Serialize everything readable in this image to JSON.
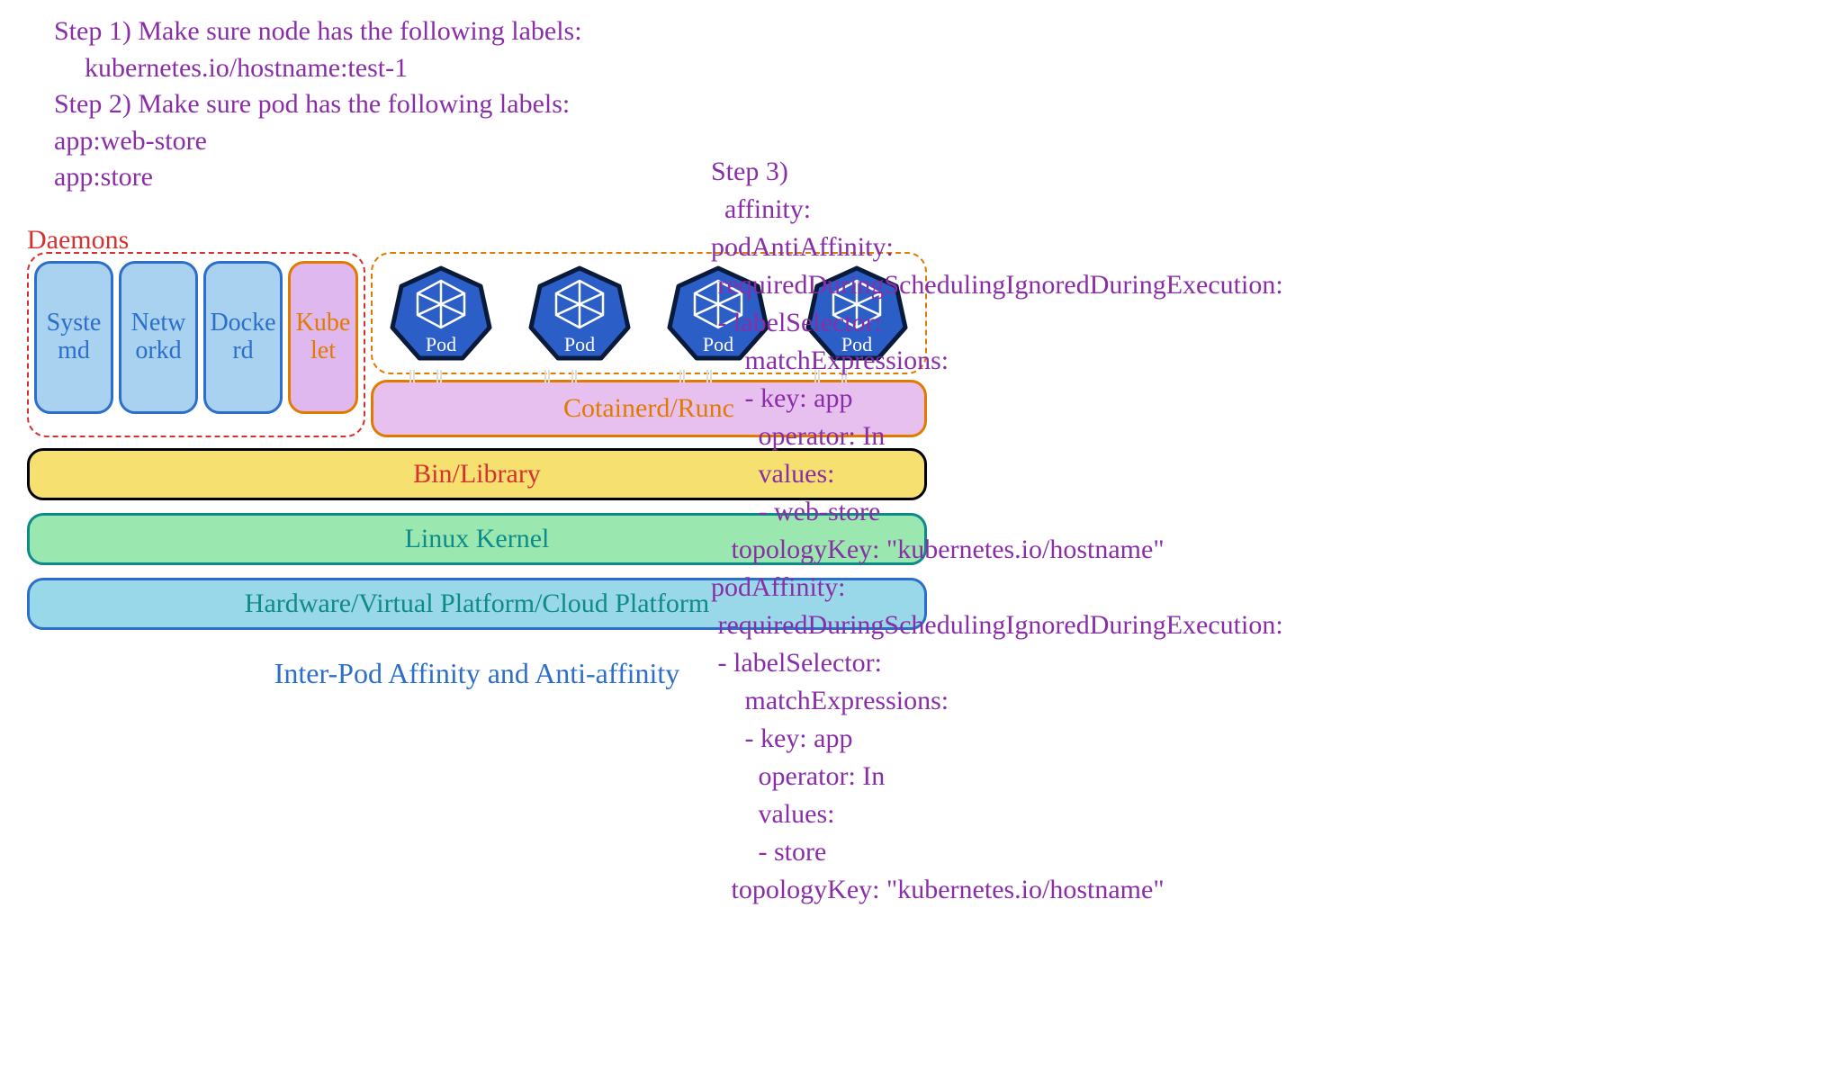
{
  "steps": {
    "step1_title": "Step 1) Make sure node has the following labels:",
    "step1_label": "kubernetes.io/hostname:test-1",
    "step2_title": "Step 2) Make sure pod has the following labels:",
    "step2_label1": "app:web-store",
    "step2_label2": "app:store"
  },
  "diagram": {
    "daemons_label": "Daemons",
    "daemons": [
      "Systemd",
      "Networkd",
      "Dockerd"
    ],
    "kubelet": "Kubelet",
    "pod_label": "Pod",
    "pod_count": 4,
    "containerd": "Cotainerd/Runc",
    "binlib": "Bin/Library",
    "kernel": "Linux Kernel",
    "hardware": "Hardware/Virtual Platform/Cloud Platform",
    "caption": "Inter-Pod Affinity and Anti-affinity"
  },
  "yaml": {
    "step3": "Step 3)",
    "affinity": "affinity:",
    "podAntiAffinity": "podAntiAffinity:",
    "required": "requiredDuringSchedulingIgnoredDuringExecution:",
    "labelSelector": "- labelSelector:",
    "matchExpressions": "matchExpressions:",
    "keyApp": "- key: app",
    "operatorIn": "operator: In",
    "values": "values:",
    "webStore": "- web-store",
    "topologyKey": "topologyKey: \"kubernetes.io/hostname\"",
    "podAffinity": "podAffinity:",
    "store": "- store"
  }
}
